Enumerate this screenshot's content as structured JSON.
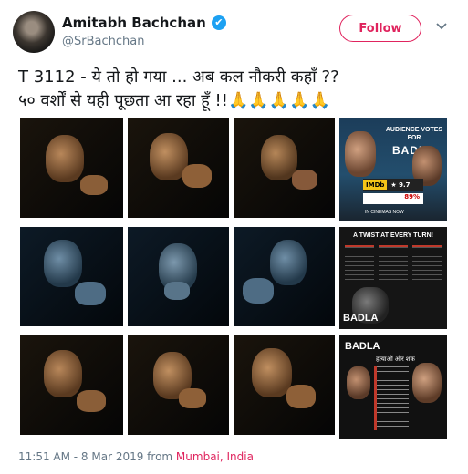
{
  "user": {
    "display_name": "Amitabh Bachchan",
    "handle": "@SrBachchan",
    "verified_icon": "✔"
  },
  "header": {
    "follow_label": "Follow",
    "menu_icon": "chevron-down-icon"
  },
  "tweet": {
    "line1": "T 3112 - ये तो हो गया  ...  अब कल नौकरी कहाँ   ??",
    "line2_text": "५० वर्शों से यही पूछता आ रहा हूँ  !!",
    "line2_emoji": "🙏🙏🙏🙏🙏"
  },
  "posters": {
    "p1": {
      "header": "AUDIENCE VOTES FOR",
      "title": "BADLA",
      "imdb": "IMDb",
      "imdb_score": "★ 9.7",
      "tomato_score": "89%",
      "footer": "IN CINEMAS NOW"
    },
    "p2": {
      "header": "A TWIST AT EVERY TURN!",
      "title": "BADLA"
    },
    "p3": {
      "title": "BADLA",
      "subtitle": "हत्याओं और शक"
    }
  },
  "footer": {
    "timestamp": "11:51 AM - 8 Mar 2019 from ",
    "location": "Mumbai, India"
  },
  "colors": {
    "accent": "#e0245e",
    "verified": "#1da1f2",
    "muted": "#657786"
  }
}
